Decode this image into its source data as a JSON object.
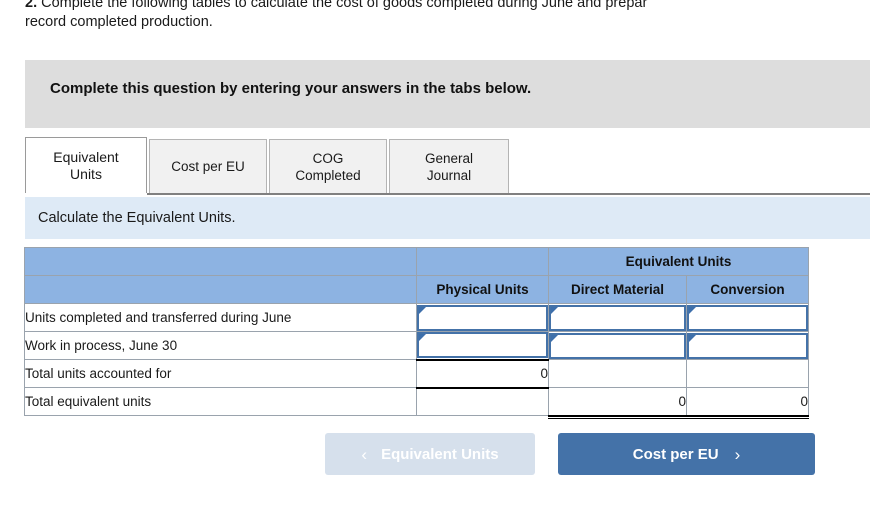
{
  "question": {
    "number": "2.",
    "line1": "Complete the following tables to calculate the cost of goods completed during June and prepar",
    "line2": "record completed production."
  },
  "banner": {
    "text": "Complete this question by entering your answers in the tabs below."
  },
  "tabs": [
    {
      "label": "Equivalent Units",
      "active": true
    },
    {
      "label": "Cost per EU",
      "active": false
    },
    {
      "label": "COG Completed",
      "active": false
    },
    {
      "label": "General Journal",
      "active": false
    }
  ],
  "instruction": {
    "text": "Calculate the Equivalent Units."
  },
  "table": {
    "group_header": "Equivalent Units",
    "columns": [
      "",
      "Physical Units",
      "Direct Material",
      "Conversion"
    ],
    "rows": [
      {
        "label": "Units completed and transferred during June",
        "physical_units": "",
        "direct_material": "",
        "conversion": "",
        "editable": true
      },
      {
        "label": "Work in process, June 30",
        "physical_units": "",
        "direct_material": "",
        "conversion": "",
        "editable": true
      },
      {
        "label": "Total units accounted for",
        "physical_units": "0",
        "direct_material": "",
        "conversion": "",
        "editable": false
      },
      {
        "label": "Total equivalent units",
        "physical_units": "",
        "direct_material": "0",
        "conversion": "0",
        "editable": false
      }
    ]
  },
  "footer": {
    "prev_label": "Equivalent Units",
    "prev_chevron": "‹",
    "next_label": "Cost per EU",
    "next_chevron": "›"
  },
  "colors": {
    "header_blue": "#8db3e2",
    "instruction_blue": "#deeaf6",
    "banner_gray": "#dddddd",
    "primary_button": "#4472a8",
    "disabled_button": "#d6e0ec",
    "entry_border": "#4472a8"
  }
}
